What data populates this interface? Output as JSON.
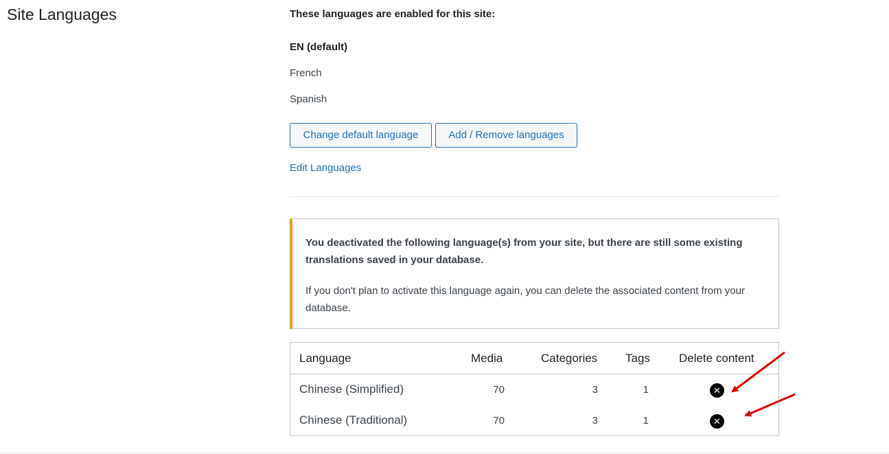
{
  "section": {
    "title": "Site Languages"
  },
  "enabled": {
    "intro": "These languages are enabled for this site:",
    "languages": [
      "EN (default)",
      "French",
      "Spanish"
    ]
  },
  "buttons": {
    "change_default": "Change default language",
    "add_remove": "Add / Remove languages"
  },
  "edit_link": "Edit Languages",
  "notice": {
    "strong": "You deactivated the following language(s) from your site, but there are still some existing translations saved in your database.",
    "text": "If you don't plan to activate this language again, you can delete the associated content from your database."
  },
  "table": {
    "headers": [
      "Language",
      "Media",
      "Categories",
      "Tags",
      "Delete content"
    ],
    "rows": [
      {
        "language": "Chinese (Simplified)",
        "media": "70",
        "categories": "3",
        "tags": "1"
      },
      {
        "language": "Chinese (Traditional)",
        "media": "70",
        "categories": "3",
        "tags": "1"
      }
    ]
  },
  "icons": {
    "delete": "close-circle-icon",
    "annotation": "red-arrow-icon"
  },
  "colors": {
    "link": "#2271b1",
    "notice_accent": "#dba617",
    "annotation_arrow": "#e00000"
  }
}
